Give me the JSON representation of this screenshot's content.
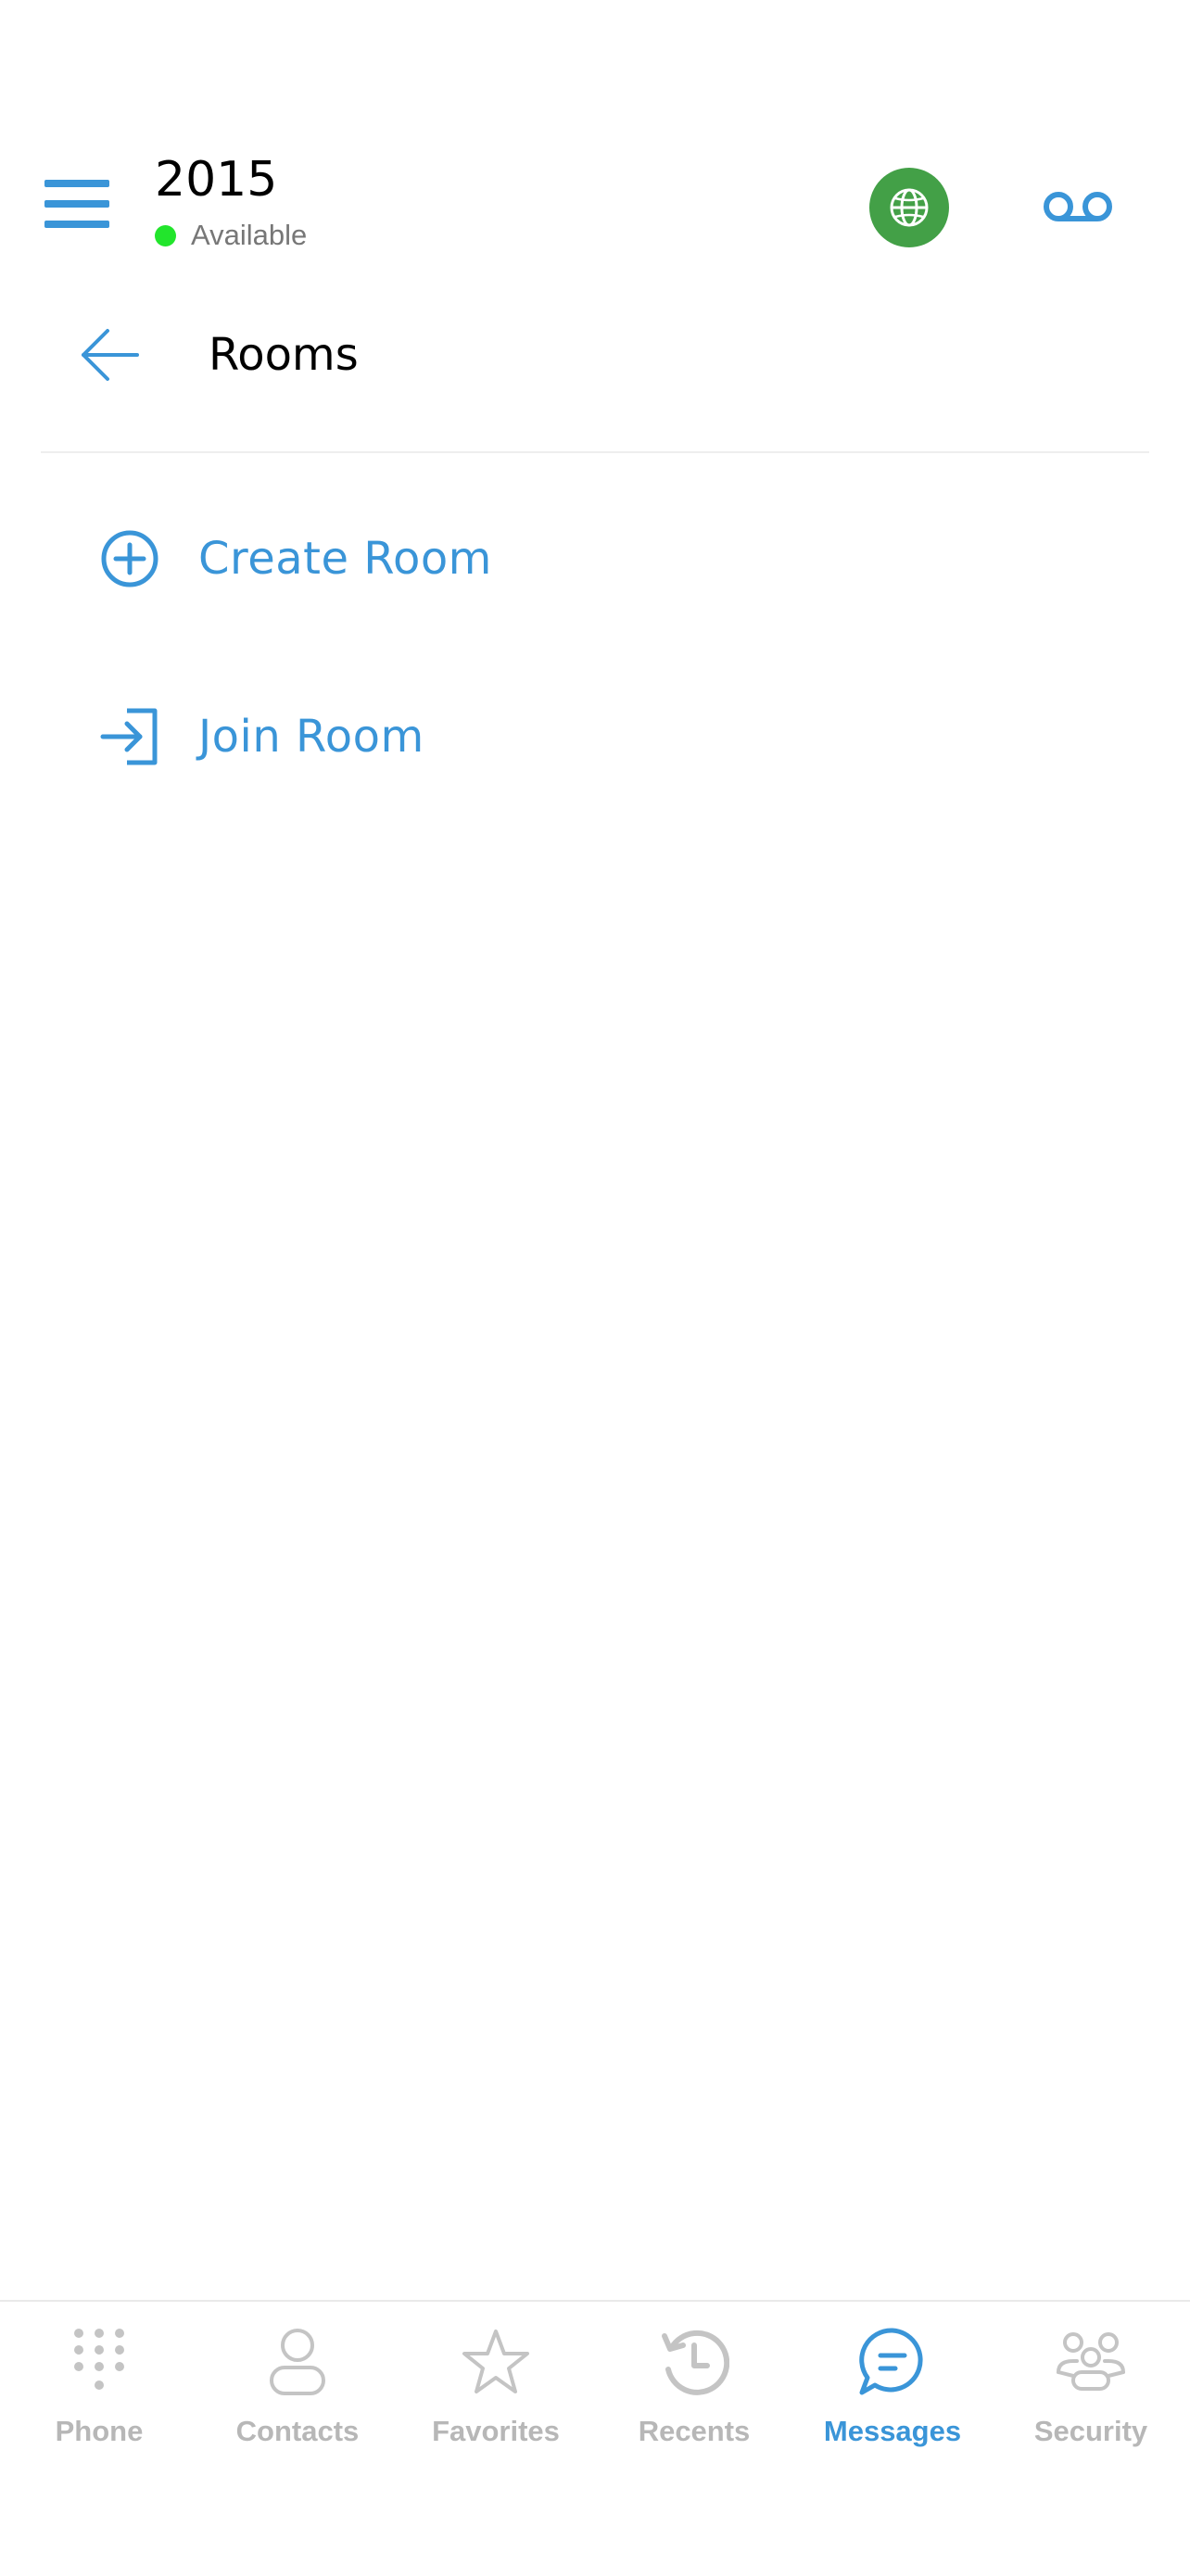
{
  "header": {
    "extension": "2015",
    "status": "Available",
    "status_color": "#22e52c",
    "globe_icon": "globe-icon",
    "globe_bg": "#43a047",
    "voicemail_icon": "voicemail-icon",
    "menu_icon": "hamburger-menu-icon"
  },
  "rooms": {
    "title": "Rooms",
    "back_icon": "arrow-left-icon"
  },
  "options": [
    {
      "label": "Create Room",
      "icon": "plus-circle-icon"
    },
    {
      "label": "Join Room",
      "icon": "login-arrow-icon"
    }
  ],
  "bottom_nav": {
    "items": [
      {
        "label": "Phone",
        "icon": "dialpad-icon",
        "active": false
      },
      {
        "label": "Contacts",
        "icon": "person-icon",
        "active": false
      },
      {
        "label": "Favorites",
        "icon": "star-icon",
        "active": false
      },
      {
        "label": "Recents",
        "icon": "history-icon",
        "active": false
      },
      {
        "label": "Messages",
        "icon": "chat-bubble-icon",
        "active": true
      },
      {
        "label": "Security",
        "icon": "group-icon",
        "active": false
      }
    ],
    "active_color": "#3a95d8",
    "inactive_color": "#b7b7b7"
  },
  "theme": {
    "accent": "#3a95d8"
  }
}
